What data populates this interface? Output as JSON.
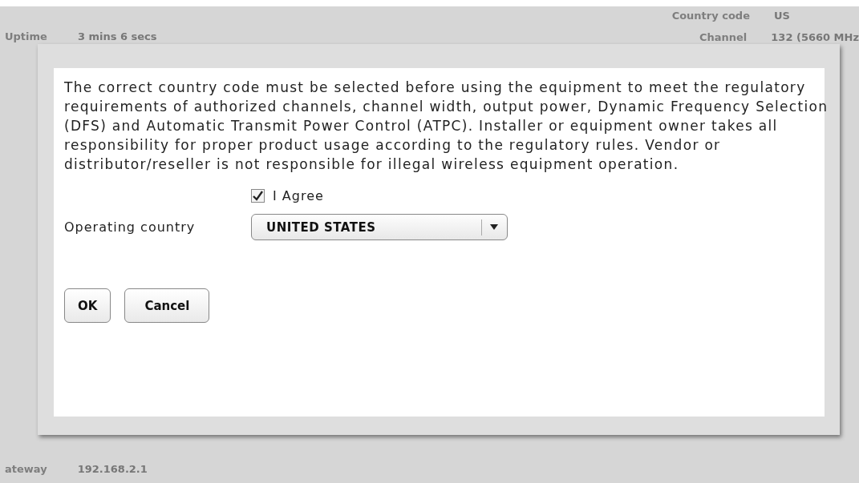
{
  "background": {
    "left_rows": [
      {
        "label": "Uptime",
        "value": "3 mins 6 secs"
      }
    ],
    "right_rows": [
      {
        "label": "Country code",
        "value": "US"
      },
      {
        "label": "Channel",
        "value": "132 (5660 MHz"
      }
    ],
    "bottom_rows": [
      {
        "label": "ateway",
        "value": "192.168.2.1"
      }
    ]
  },
  "dialog": {
    "notice": "The correct country code must be selected before using the equipment to meet the regulatory requirements of authorized channels, channel width, output power, Dynamic Frequency Selection (DFS) and Automatic Transmit Power Control (ATPC). Installer or equipment owner takes all responsibility for proper product usage according to the regulatory rules. Vendor or distributor/reseller is not responsible for illegal wireless equipment operation.",
    "agree": {
      "label": "I Agree",
      "checked": true
    },
    "country": {
      "label": "Operating country",
      "value": "UNITED STATES"
    },
    "buttons": [
      "OK",
      "Cancel"
    ]
  }
}
